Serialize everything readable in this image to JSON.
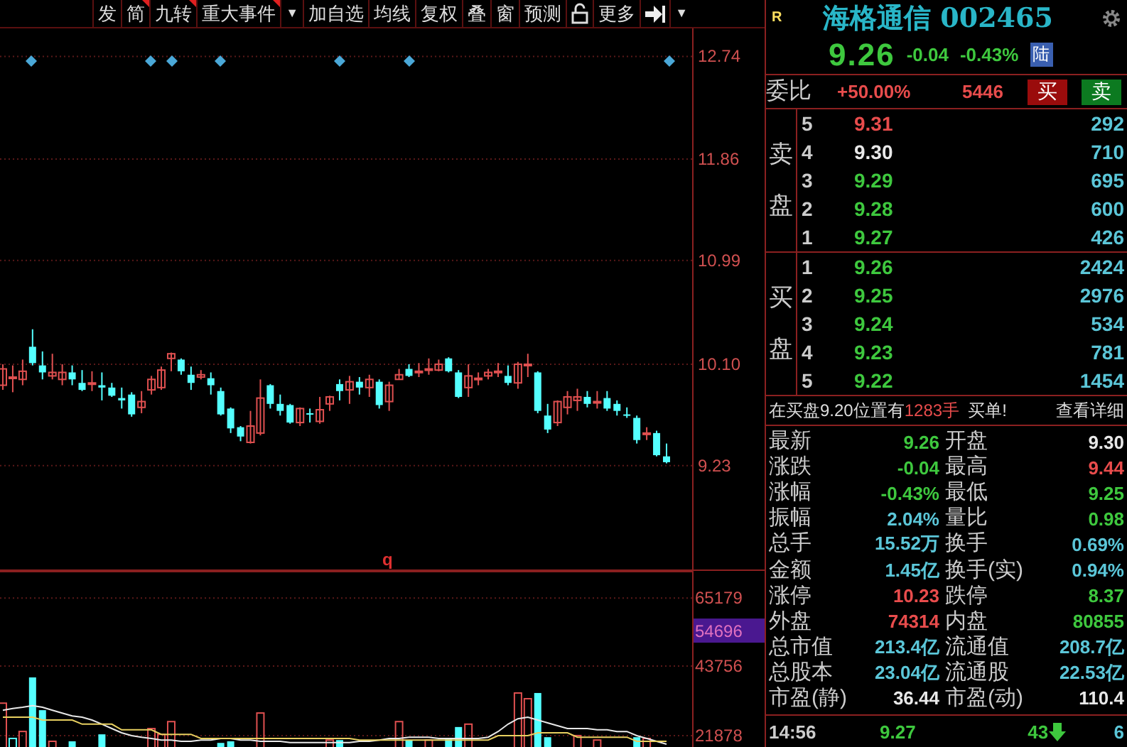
{
  "toolbar": {
    "items": [
      {
        "kind": "text",
        "label": "发",
        "flagged": false
      },
      {
        "kind": "text",
        "label": "简",
        "flagged": true
      },
      {
        "kind": "text",
        "label": "九转",
        "flagged": true
      },
      {
        "kind": "text",
        "label": "重大事件",
        "flagged": true
      },
      {
        "kind": "caret",
        "label": "▼"
      },
      {
        "kind": "text",
        "label": "加自选",
        "flagged": false
      },
      {
        "kind": "text",
        "label": "均线",
        "flagged": false
      },
      {
        "kind": "text",
        "label": "复权",
        "flagged": false
      },
      {
        "kind": "text",
        "label": "叠",
        "flagged": false
      },
      {
        "kind": "text",
        "label": "窗",
        "flagged": false
      },
      {
        "kind": "text",
        "label": "预测",
        "flagged": false
      },
      {
        "kind": "icon"
      },
      {
        "kind": "text",
        "label": "更多",
        "flagged": false
      },
      {
        "kind": "icon"
      },
      {
        "kind": "caret",
        "label": "▼"
      }
    ]
  },
  "chart": {
    "chart_data": {
      "type": "candlestick",
      "grid": true,
      "ohlc": [
        [
          9.92,
          10.1,
          9.88,
          10.06
        ],
        [
          9.98,
          10.09,
          9.86,
          9.99
        ],
        [
          9.97,
          10.14,
          9.92,
          10.04
        ],
        [
          10.25,
          10.4,
          10.09,
          10.11
        ],
        [
          10.09,
          10.21,
          9.97,
          10.03
        ],
        [
          10.0,
          10.19,
          9.97,
          10.03
        ],
        [
          9.97,
          10.1,
          9.92,
          10.03
        ],
        [
          10.03,
          10.09,
          9.92,
          9.97
        ],
        [
          9.94,
          10.05,
          9.87,
          9.88
        ],
        [
          9.93,
          10.04,
          9.87,
          9.94
        ],
        [
          9.92,
          10.03,
          9.79,
          9.9
        ],
        [
          9.9,
          9.94,
          9.82,
          9.83
        ],
        [
          9.81,
          9.9,
          9.72,
          9.79
        ],
        [
          9.84,
          9.86,
          9.65,
          9.67
        ],
        [
          9.73,
          9.87,
          9.68,
          9.78
        ],
        [
          9.88,
          10.0,
          9.84,
          9.97
        ],
        [
          9.9,
          10.08,
          9.88,
          10.05
        ],
        [
          10.15,
          10.2,
          10.04,
          10.19
        ],
        [
          10.14,
          10.15,
          10.01,
          10.04
        ],
        [
          10.01,
          10.08,
          9.88,
          9.94
        ],
        [
          9.99,
          10.05,
          9.97,
          10.01
        ],
        [
          9.98,
          10.03,
          9.84,
          9.92
        ],
        [
          9.87,
          9.9,
          9.66,
          9.67
        ],
        [
          9.72,
          9.73,
          9.51,
          9.55
        ],
        [
          9.56,
          9.57,
          9.44,
          9.48
        ],
        [
          9.43,
          9.7,
          9.42,
          9.57
        ],
        [
          9.51,
          9.97,
          9.49,
          9.81
        ],
        [
          9.92,
          9.93,
          9.72,
          9.76
        ],
        [
          9.76,
          9.84,
          9.66,
          9.7
        ],
        [
          9.75,
          9.76,
          9.59,
          9.6
        ],
        [
          9.6,
          9.73,
          9.57,
          9.72
        ],
        [
          9.68,
          9.72,
          9.6,
          9.67
        ],
        [
          9.61,
          9.82,
          9.59,
          9.71
        ],
        [
          9.76,
          9.83,
          9.7,
          9.82
        ],
        [
          9.93,
          9.97,
          9.79,
          9.87
        ],
        [
          9.88,
          10.0,
          9.76,
          9.95
        ],
        [
          9.95,
          9.99,
          9.84,
          9.9
        ],
        [
          9.9,
          10.01,
          9.82,
          9.97
        ],
        [
          9.95,
          9.97,
          9.72,
          9.75
        ],
        [
          9.78,
          9.95,
          9.7,
          9.92
        ],
        [
          9.97,
          10.06,
          9.97,
          10.01
        ],
        [
          10.06,
          10.1,
          9.99,
          10.0
        ],
        [
          10.03,
          10.11,
          9.99,
          10.04
        ],
        [
          10.05,
          10.15,
          10.01,
          10.06
        ],
        [
          10.05,
          10.14,
          10.04,
          10.1
        ],
        [
          10.15,
          10.16,
          10.03,
          10.04
        ],
        [
          10.03,
          10.05,
          9.81,
          9.82
        ],
        [
          9.9,
          10.1,
          9.82,
          10.0
        ],
        [
          9.97,
          10.03,
          9.92,
          9.98
        ],
        [
          10.0,
          10.06,
          9.97,
          10.03
        ],
        [
          10.03,
          10.11,
          9.99,
          10.04
        ],
        [
          10.0,
          10.09,
          9.92,
          9.94
        ],
        [
          9.94,
          10.12,
          9.89,
          10.1
        ],
        [
          10.09,
          10.19,
          9.99,
          10.1
        ],
        [
          10.03,
          10.04,
          9.68,
          9.7
        ],
        [
          9.66,
          9.76,
          9.51,
          9.54
        ],
        [
          9.6,
          9.79,
          9.57,
          9.78
        ],
        [
          9.73,
          9.87,
          9.67,
          9.82
        ],
        [
          9.79,
          9.89,
          9.7,
          9.82
        ],
        [
          9.82,
          9.87,
          9.73,
          9.76
        ],
        [
          9.77,
          9.87,
          9.72,
          9.78
        ],
        [
          9.81,
          9.87,
          9.7,
          9.72
        ],
        [
          9.76,
          9.79,
          9.66,
          9.7
        ],
        [
          9.67,
          9.73,
          9.64,
          9.66
        ],
        [
          9.64,
          9.66,
          9.42,
          9.45
        ],
        [
          9.5,
          9.56,
          9.45,
          9.51
        ],
        [
          9.51,
          9.53,
          9.31,
          9.32
        ],
        [
          9.31,
          9.42,
          9.25,
          9.26
        ]
      ],
      "ylim": [
        8.34,
        12.98
      ],
      "yticks": [
        {
          "value": 12.74,
          "label": "12.74"
        },
        {
          "value": 11.86,
          "label": "11.86"
        },
        {
          "value": 10.99,
          "label": "10.99"
        },
        {
          "value": 10.1,
          "label": "10.10"
        },
        {
          "value": 9.23,
          "label": "9.23"
        }
      ]
    },
    "indicator_label": "q"
  },
  "volume": {
    "chart_data": {
      "type": "bar",
      "grid": true,
      "series": [
        {
          "type": "bar",
          "colors": [
            "#e05050",
            "#54ffff",
            "#e05050",
            "#54ffff",
            "#54ffff",
            "#e05050",
            null,
            "#54ffff",
            null,
            null,
            "#54ffff",
            null,
            null,
            null,
            null,
            "#e05050",
            "#e05050",
            "#e05050",
            null,
            null,
            null,
            null,
            "#54ffff",
            "#54ffff",
            null,
            null,
            "#e05050",
            null,
            null,
            null,
            null,
            null,
            null,
            "#e05050",
            "#54ffff",
            null,
            null,
            null,
            null,
            null,
            "#e05050",
            "#54ffff",
            null,
            "#e05050",
            null,
            "#54ffff",
            "#54ffff",
            "#e05050",
            null,
            null,
            null,
            null,
            "#e05050",
            "#e05050",
            "#54ffff",
            "#54ffff",
            null,
            null,
            "#e05050",
            null,
            "#e05050",
            null,
            null,
            null,
            "#54ffff",
            "#e05050",
            null,
            null
          ],
          "values": [
            32100,
            21000,
            23200,
            40200,
            29900,
            20100,
            null,
            20100,
            null,
            null,
            22300,
            null,
            null,
            null,
            null,
            24100,
            22300,
            26300,
            null,
            null,
            null,
            null,
            19600,
            20100,
            null,
            null,
            29000,
            null,
            null,
            null,
            null,
            null,
            null,
            20500,
            20500,
            null,
            null,
            null,
            null,
            null,
            26300,
            20500,
            null,
            20500,
            null,
            21000,
            24600,
            25500,
            null,
            null,
            null,
            null,
            35300,
            33500,
            35300,
            21400,
            null,
            null,
            21900,
            null,
            20500,
            null,
            null,
            null,
            21400,
            21000,
            null,
            null
          ]
        },
        {
          "type": "line",
          "color": "#e8e8e8",
          "values": [
            29900,
            30400,
            30800,
            31300,
            30800,
            29900,
            29000,
            28100,
            27700,
            26800,
            25500,
            24100,
            22800,
            21900,
            21400,
            21000,
            20500,
            20500,
            20100,
            20100,
            20500,
            20500,
            21000,
            21000,
            20500,
            20500,
            20100,
            20100,
            20100,
            19700,
            19700,
            19700,
            19700,
            19700,
            19700,
            19700,
            20100,
            20100,
            20500,
            21000,
            21000,
            21400,
            21400,
            21400,
            21000,
            21000,
            21000,
            21000,
            21000,
            21400,
            23200,
            25500,
            27200,
            27700,
            26800,
            25900,
            25000,
            24100,
            24100,
            24100,
            23700,
            23700,
            23200,
            23200,
            21900,
            21000,
            20100,
            19200
          ]
        },
        {
          "type": "line",
          "color": "#e8d060",
          "values": [
            27700,
            27700,
            27700,
            27700,
            26800,
            26800,
            26800,
            26800,
            25500,
            25500,
            25500,
            25500,
            23700,
            23700,
            23700,
            23700,
            22300,
            22300,
            22300,
            22300,
            21000,
            21000,
            21000,
            21000,
            21000,
            21000,
            21000,
            21000,
            21000,
            21000,
            21000,
            21000,
            21000,
            21000,
            21000,
            21000,
            20500,
            20500,
            20500,
            20500,
            20500,
            20500,
            20500,
            20500,
            20500,
            20500,
            20500,
            20500,
            20500,
            20500,
            21900,
            21900,
            21900,
            21900,
            22800,
            22800,
            22800,
            22800,
            21400,
            21400,
            21400,
            21400,
            21400,
            21400,
            20100,
            20100,
            20100,
            20100
          ]
        }
      ],
      "ylim": [
        0,
        73700
      ],
      "yticks": [
        65179,
        43756,
        21878
      ]
    },
    "cursor_value": "54696"
  },
  "quote": {
    "marker": "R",
    "name": "海格通信",
    "code": "002465",
    "price": "9.26",
    "change": "-0.04",
    "change_pct": "-0.43%",
    "market_badge": "陆"
  },
  "ratio": {
    "label": "委比",
    "value": "+50.00%",
    "diff": "5446",
    "buy_button": "买",
    "sell_button": "卖"
  },
  "order_book": {
    "sell": {
      "label": "卖盘",
      "levels": [
        {
          "level": "5",
          "price": "9.31",
          "color": "#e84c4c",
          "volume": "292"
        },
        {
          "level": "4",
          "price": "9.30",
          "color": "#e8e8e8",
          "volume": "710"
        },
        {
          "level": "3",
          "price": "9.29",
          "color": "#3ec83e",
          "volume": "695"
        },
        {
          "level": "2",
          "price": "9.28",
          "color": "#3ec83e",
          "volume": "600"
        },
        {
          "level": "1",
          "price": "9.27",
          "color": "#3ec83e",
          "volume": "426"
        }
      ]
    },
    "buy": {
      "label": "买盘",
      "levels": [
        {
          "level": "1",
          "price": "9.26",
          "color": "#3ec83e",
          "volume": "2424"
        },
        {
          "level": "2",
          "price": "9.25",
          "color": "#3ec83e",
          "volume": "2976"
        },
        {
          "level": "3",
          "price": "9.24",
          "color": "#3ec83e",
          "volume": "534"
        },
        {
          "level": "4",
          "price": "9.23",
          "color": "#3ec83e",
          "volume": "781"
        },
        {
          "level": "5",
          "price": "9.22",
          "color": "#3ec83e",
          "volume": "1454"
        }
      ]
    }
  },
  "notice": {
    "prefix": "在买盘9.20位置有",
    "amount": "1283手",
    "suffix": "买单!",
    "link": "查看详细"
  },
  "stats": [
    {
      "left": {
        "label": "最新",
        "value": "9.26",
        "color": "#3ec83e"
      },
      "right": {
        "label": "开盘",
        "value": "9.30",
        "color": "#e8e8e8"
      }
    },
    {
      "left": {
        "label": "涨跌",
        "value": "-0.04",
        "color": "#3ec83e"
      },
      "right": {
        "label": "最高",
        "value": "9.44",
        "color": "#e84c4c"
      }
    },
    {
      "left": {
        "label": "涨幅",
        "value": "-0.43%",
        "color": "#3ec83e"
      },
      "right": {
        "label": "最低",
        "value": "9.25",
        "color": "#3ec83e"
      }
    },
    {
      "left": {
        "label": "振幅",
        "value": "2.04%",
        "color": "#5bc6d8"
      },
      "right": {
        "label": "量比",
        "value": "0.98",
        "color": "#3ec83e"
      }
    },
    {
      "left": {
        "label": "总手",
        "value": "15.52万",
        "color": "#5bc6d8"
      },
      "right": {
        "label": "换手",
        "value": "0.69%",
        "color": "#5bc6d8"
      }
    },
    {
      "left": {
        "label": "金额",
        "value": "1.45亿",
        "color": "#5bc6d8"
      },
      "right": {
        "label": "换手(实)",
        "value": "0.94%",
        "color": "#5bc6d8"
      }
    },
    {
      "left": {
        "label": "涨停",
        "value": "10.23",
        "color": "#e84c4c"
      },
      "right": {
        "label": "跌停",
        "value": "8.37",
        "color": "#3ec83e"
      }
    },
    {
      "left": {
        "label": "外盘",
        "value": "74314",
        "color": "#e84c4c"
      },
      "right": {
        "label": "内盘",
        "value": "80855",
        "color": "#3ec83e"
      }
    },
    {
      "left": {
        "label": "总市值",
        "value": "213.4亿",
        "color": "#5bc6d8"
      },
      "right": {
        "label": "流通值",
        "value": "208.7亿",
        "color": "#5bc6d8"
      }
    },
    {
      "left": {
        "label": "总股本",
        "value": "23.04亿",
        "color": "#5bc6d8"
      },
      "right": {
        "label": "流通股",
        "value": "22.53亿",
        "color": "#5bc6d8"
      }
    },
    {
      "left": {
        "label": "市盈(静)",
        "value": "36.44",
        "color": "#e8e8e8"
      },
      "right": {
        "label": "市盈(动)",
        "value": "110.4",
        "color": "#e8e8e8"
      }
    }
  ],
  "tick": {
    "time": "14:56",
    "price": {
      "text": "9.27",
      "color": "#3ec83e"
    },
    "volume": "43",
    "down": true,
    "count": "6"
  }
}
